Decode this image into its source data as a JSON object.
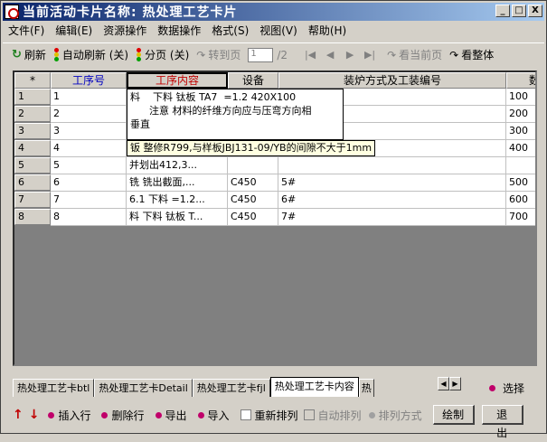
{
  "window": {
    "title": "当前活动卡片名称: 热处理工艺卡片",
    "controls": [
      "_",
      "□",
      "X"
    ]
  },
  "menu": [
    "文件(F)",
    "编辑(E)",
    "资源操作",
    "数据操作",
    "格式(S)",
    "视图(V)",
    "帮助(H)"
  ],
  "toolbar": {
    "refresh": "刷新",
    "auto_refresh": "自动刷新 (关)",
    "paging": "分页 (关)",
    "goto_page": "转到页",
    "page_value": "1",
    "page_total": "/2",
    "view_current": "看当前页",
    "view_all": "看整体"
  },
  "grid": {
    "corner": "*",
    "columns": [
      "工序号",
      "工序内容",
      "设备",
      "装炉方式及工装编号",
      "数"
    ],
    "rows": [
      {
        "n": "1",
        "seq": "1",
        "content": "",
        "equip": "",
        "method": "",
        "qty": "100"
      },
      {
        "n": "2",
        "seq": "2",
        "content": "",
        "equip": "",
        "method": "",
        "qty": "200"
      },
      {
        "n": "3",
        "seq": "3",
        "content": "",
        "equip": "",
        "method": "",
        "qty": "300"
      },
      {
        "n": "4",
        "seq": "4",
        "content": "",
        "equip": "",
        "method": "",
        "qty": "400"
      },
      {
        "n": "5",
        "seq": "5",
        "content": "    并划出412,3...",
        "equip": "",
        "method": "",
        "qty": ""
      },
      {
        "n": "6",
        "seq": "6",
        "content": "铣    铣出截面,...",
        "equip": "C450",
        "method": "5#",
        "qty": "500"
      },
      {
        "n": "7",
        "seq": "7",
        "content": "6.1    下料  =1.2...",
        "equip": "C450",
        "method": "6#",
        "qty": "600"
      },
      {
        "n": "8",
        "seq": "8",
        "content": "料    下料 钛板 T...",
        "equip": "C450",
        "method": "7#",
        "qty": "700"
      }
    ],
    "popup_multiline": "料    下料 钛板 TA7  =1.2 420X100\n      注意 材料的纤维方向应与压弯方向相\n垂直",
    "popup_single": "钣    整修R799,与样板JBJ131-09/YB的间隙不大于1mm"
  },
  "tabs": [
    "热处理工艺卡btl",
    "热处理工艺卡Detail",
    "热处理工艺卡fjl",
    "热处理工艺卡内容",
    "热"
  ],
  "select_label": "选择",
  "bottom": {
    "insert_row": "插入行",
    "delete_row": "删除行",
    "export": "导出",
    "import": "导入",
    "resort": "重新排列",
    "auto_sort": "自动排列",
    "sort_mode": "排列方式",
    "draw": "绘制",
    "exit": "退 出"
  }
}
